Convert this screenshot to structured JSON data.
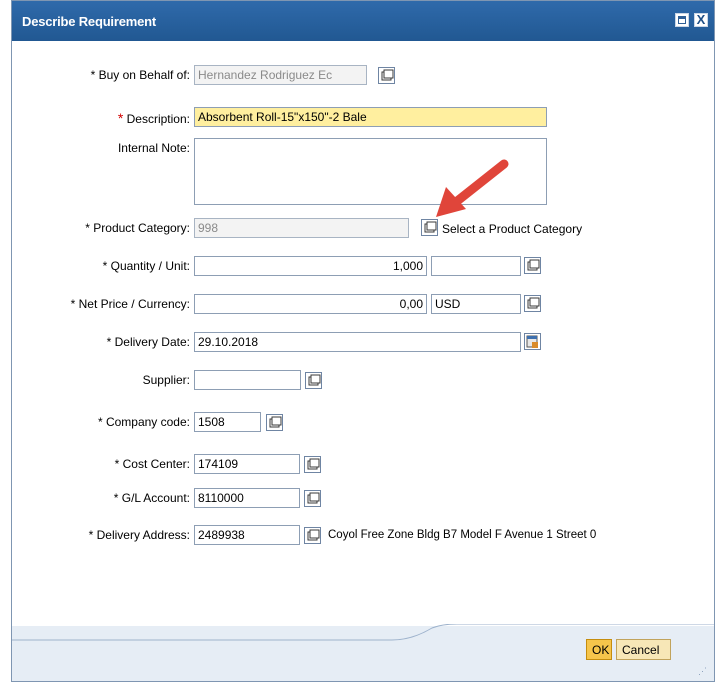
{
  "dialog": {
    "title": "Describe Requirement",
    "close_glyph": "X",
    "maximize_icon": "window-maximize-icon",
    "close_icon": "close-icon"
  },
  "fields": [
    {
      "label": "* Buy on Behalf of:",
      "value": "Hernandez Rodriguez Ec",
      "placeholder": ""
    },
    {
      "label_req_star": "*",
      "label": " Description:",
      "value": "Absorbent Roll-15\"x150\"-2 Bale"
    },
    {
      "label": "Internal Note:",
      "value": ""
    },
    {
      "label": "* Product Category:",
      "value": "998",
      "hint": "Select a Product Category"
    },
    {
      "label": "* Quantity / Unit:",
      "value": "1,000",
      "unit": ""
    },
    {
      "label": "* Net Price / Currency:",
      "value": "0,00",
      "currency": "USD"
    },
    {
      "label": "* Delivery Date:",
      "value": "29.10.2018"
    },
    {
      "label": "Supplier:",
      "value": ""
    },
    {
      "label": "* Company code:",
      "value": "1508"
    },
    {
      "label": "* Cost Center:",
      "value": "174109"
    },
    {
      "label": "* G/L Account:",
      "value": "8110000"
    },
    {
      "label": "* Delivery Address:",
      "value": "2489938",
      "hint": "Coyol Free Zone Bldg B7 Model F Avenue 1 Street 0"
    }
  ],
  "buttons": {
    "ok": "OK",
    "cancel": "Cancel"
  },
  "colors": {
    "titlebar": "#2560a0",
    "required_star": "#d20000",
    "highlight_field": "#ffef9f",
    "annotation_arrow": "#e0453a",
    "ok_button": "#f6c54b"
  }
}
